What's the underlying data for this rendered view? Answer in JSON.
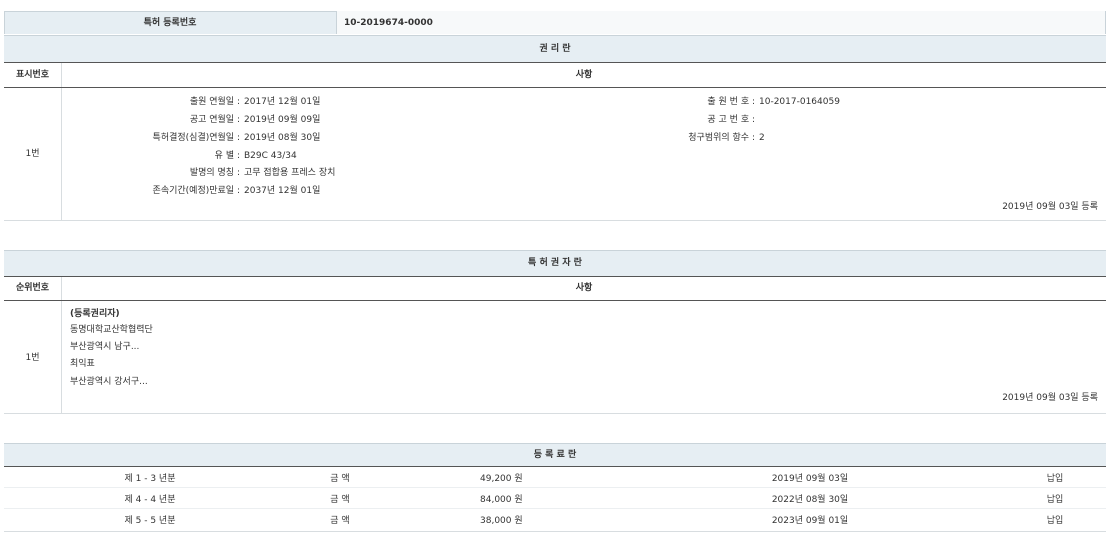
{
  "top": {
    "label": "특허 등록번호",
    "value": "10-2019674-0000"
  },
  "rights": {
    "title": "권 리 란",
    "col_no": "표시번호",
    "col_items": "사항",
    "row_no": "1번",
    "left_fields": [
      {
        "label": "출원 연월일",
        "value": "2017년 12월 01일"
      },
      {
        "label": "공고 연월일",
        "value": "2019년 09월 09일"
      },
      {
        "label": "특허결정(심결)연월일",
        "value": "2019년 08월 30일"
      },
      {
        "label": "유 별",
        "value": "B29C 43/34"
      },
      {
        "label": "발명의 명칭",
        "value": "고무 접합용 프레스 장치"
      },
      {
        "label": "존속기간(예정)만료일",
        "value": "2037년 12월 01일"
      }
    ],
    "right_fields": [
      {
        "label": "출 원 번 호",
        "value": "10-2017-0164059"
      },
      {
        "label": "공 고 번 호",
        "value": ""
      },
      {
        "label": "청구범위의 항수",
        "value": "2"
      }
    ],
    "registered": "2019년 09월 03일 등록"
  },
  "holders": {
    "title": "특 허 권 자 란",
    "col_no": "순위번호",
    "col_items": "사항",
    "row_no": "1번",
    "lines": [
      "(등록권리자)",
      "동명대학교산학협력단",
      "부산광역시 남구...",
      "최익표",
      "부산광역시 강서구..."
    ],
    "registered": "2019년 09월 03일 등록"
  },
  "fees": {
    "title": "등 록 료 란",
    "rows": [
      {
        "period": "제 1 - 3 년분",
        "amount_label": "금 액",
        "amount": "49,200 원",
        "date": "2019년 09월 03일",
        "status": "납입"
      },
      {
        "period": "제 4 - 4 년분",
        "amount_label": "금 액",
        "amount": "84,000 원",
        "date": "2022년 08월 30일",
        "status": "납입"
      },
      {
        "period": "제 5 - 5 년분",
        "amount_label": "금 액",
        "amount": "38,000 원",
        "date": "2023년 09월 01일",
        "status": "납입"
      }
    ]
  }
}
